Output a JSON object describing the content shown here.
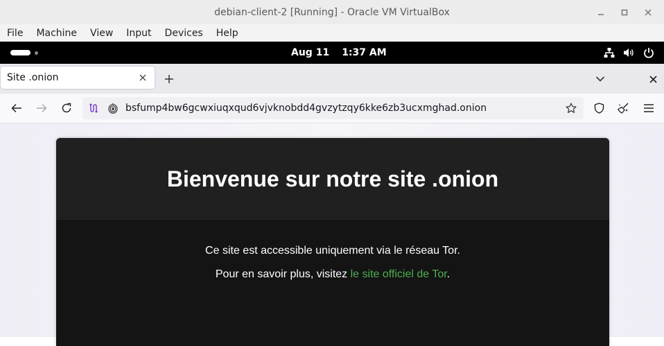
{
  "vbox": {
    "title": "debian-client-2 [Running] - Oracle VM VirtualBox",
    "menu": [
      "File",
      "Machine",
      "View",
      "Input",
      "Devices",
      "Help"
    ]
  },
  "gnome": {
    "date": "Aug 11",
    "time": "1:37 AM",
    "tray_icons": [
      "network-icon",
      "volume-icon",
      "power-icon"
    ]
  },
  "browser": {
    "tab_title": "Site .onion",
    "url": "bsfump4bw6gcwxiuqxqud6vjvknobdd4gvzytzqy6kke6zb3ucxmghad.onion"
  },
  "page": {
    "heading": "Bienvenue sur notre site .onion",
    "intro": "Ce site est accessible uniquement via le réseau Tor.",
    "more_prefix": "Pour en savoir plus, visitez ",
    "link_text": "le site officiel de Tor",
    "more_suffix": ".",
    "link_color": "#4caf50"
  }
}
